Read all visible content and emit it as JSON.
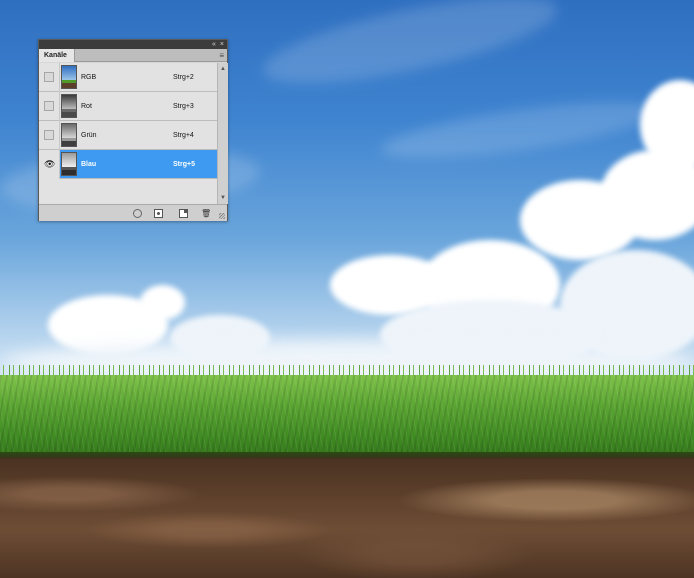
{
  "panel": {
    "tab_label": "Kanäle",
    "collapse_symbol": "«",
    "close_symbol": "×",
    "menu_symbol": "≡",
    "channels": [
      {
        "name": "RGB",
        "shortcut": "Strg+2",
        "visible": false,
        "selected": false,
        "thumb_tint": "color"
      },
      {
        "name": "Rot",
        "shortcut": "Strg+3",
        "visible": false,
        "selected": false,
        "thumb_tint": "gray"
      },
      {
        "name": "Grün",
        "shortcut": "Strg+4",
        "visible": false,
        "selected": false,
        "thumb_tint": "gray"
      },
      {
        "name": "Blau",
        "shortcut": "Strg+5",
        "visible": true,
        "selected": true,
        "thumb_tint": "gray"
      }
    ],
    "footer_icons": [
      "load-selection-icon",
      "save-selection-icon",
      "new-channel-icon",
      "trash-icon"
    ],
    "selected_color": "#3d9af0"
  },
  "scene": {
    "sky_color": "#3f84d0",
    "grass_color": "#5aa532",
    "soil_color": "#5c3f2b"
  }
}
